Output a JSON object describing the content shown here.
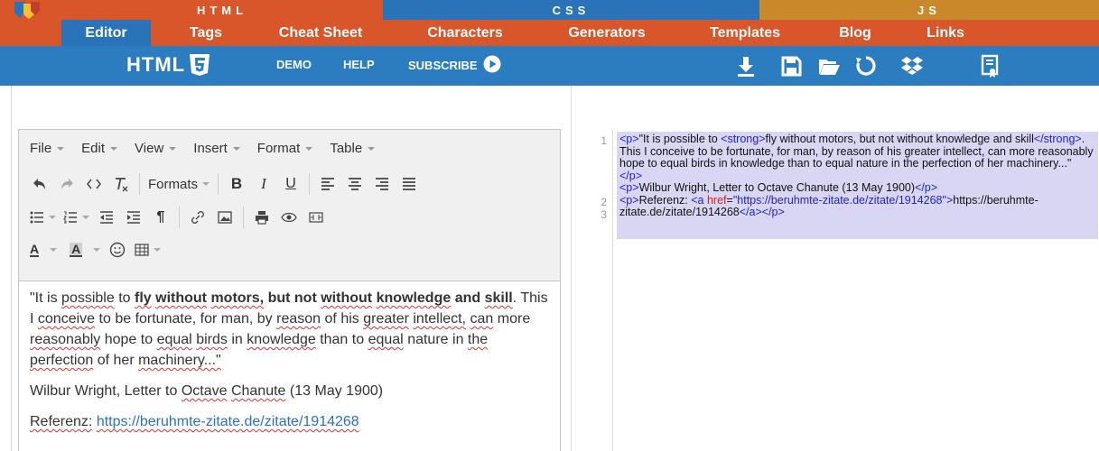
{
  "lang_bar": {
    "html": "HTML",
    "css": "CSS",
    "js": "JS"
  },
  "nav": {
    "items": [
      {
        "label": "Editor"
      },
      {
        "label": "Tags"
      },
      {
        "label": "Cheat Sheet"
      },
      {
        "label": "Characters"
      },
      {
        "label": "Generators"
      },
      {
        "label": "Templates"
      },
      {
        "label": "Blog"
      },
      {
        "label": "Links"
      }
    ]
  },
  "toolbar": {
    "brand": "HTML",
    "demo": "DEMO",
    "help": "HELP",
    "subscribe": "SUBSCRIBE",
    "icons": [
      "download-icon",
      "save-icon",
      "open-folder-icon",
      "refresh-icon",
      "dropbox-icon",
      "certificate-icon"
    ]
  },
  "editor": {
    "menus": [
      "File",
      "Edit",
      "View",
      "Insert",
      "Format",
      "Table"
    ],
    "formats_label": "Formats",
    "content": {
      "p1_a": "\"It is possible to ",
      "p1_bold": "fly without motors, but not without knowledge and skill",
      "p1_b": ". This I conceive to be fortunate, for man, by reason of his greater intellect, can more reasonably hope to equal birds in knowledge than to equal nature in the perfection of her machinery...\"",
      "p2": "Wilbur Wright, Letter to Octave Chanute (13 May 1900)",
      "p3_label": "Referenz: ",
      "p3_link": "https://beruhmte-zitate.de/zitate/1914268"
    }
  },
  "code": {
    "line_numbers": [
      "1",
      "2",
      "3"
    ],
    "l1_open": "<p>",
    "l1_text_a": "\"It is possible to ",
    "l1_strong_open": "<strong>",
    "l1_strong_text": "fly without motors, but not without knowledge and skill",
    "l1_strong_close": "</strong>",
    "l1_text_b": ". This I conceive to be fortunate, for man, by reason of his greater intellect, can more reasonably hope to equal birds in knowledge than to equal nature in the perfection of her machinery...\"",
    "l1_close": "</p>",
    "l2_open": "<p>",
    "l2_text": "Wilbur Wright, Letter to Octave Chanute (13 May 1900)",
    "l2_close": "</p>",
    "l3_open": "<p>",
    "l3_text": "Referenz: ",
    "l3_a_open": "<a ",
    "l3_attr": "href",
    "l3_eq": "=",
    "l3_val": "\"https://beruhmte-zitate.de/zitate/1914268\"",
    "l3_a_gt": ">",
    "l3_link_text": "https://beruhmte-zitate.de/zitate/1914268",
    "l3_a_close": "</a>",
    "l3_close": "</p>"
  },
  "colors": {
    "orange": "#d9552a",
    "blue": "#2a73b9",
    "gold": "#c9892b",
    "selection": "#d8d6f3"
  }
}
